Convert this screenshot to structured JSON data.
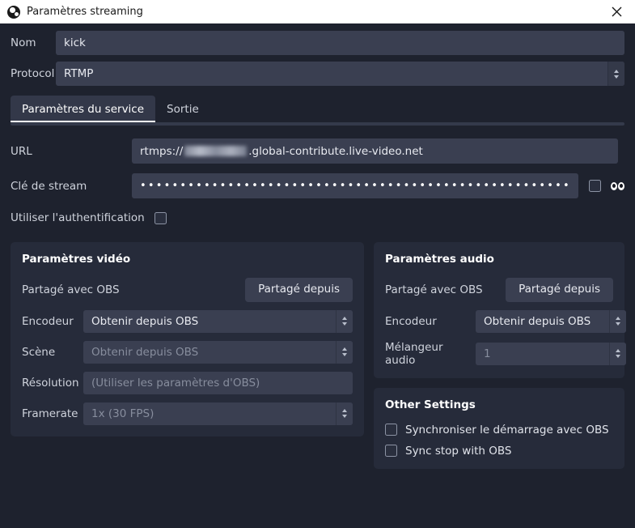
{
  "titlebar": {
    "title": "Paramètres streaming",
    "app_icon": "obs-logo-icon",
    "close_icon": "close-icon"
  },
  "colors": {
    "window_bg": "#1e222e",
    "field_bg": "#3a3f51",
    "group_bg": "#262b3a",
    "titlebar_bg": "#ffffff",
    "text": "#e4e6eb",
    "disabled_text": "#878d9d",
    "active_tab_underline": "#ffffff"
  },
  "top": {
    "name_label": "Nom",
    "name_value": "kick",
    "protocol_label": "Protocol",
    "protocol_value": "RTMP"
  },
  "tabs": [
    {
      "label": "Paramètres du service",
      "active": true
    },
    {
      "label": "Sortie",
      "active": false
    }
  ],
  "service": {
    "url_label": "URL",
    "url_prefix": "rtmps://",
    "url_redacted": "",
    "url_suffix": ".global-contribute.live-video.net",
    "stream_key_label": "Clé de stream",
    "stream_key_value": "••••••••••••••••••••••••••••••••••••••••••••••••••••••",
    "show_key_checkbox": "",
    "reveal_icon": "eyes-icon",
    "auth_label": "Utiliser l'authentification",
    "auth_checked": false
  },
  "video": {
    "title": "Paramètres vidéo",
    "shared_label": "Partagé avec OBS",
    "shared_button": "Partagé depuis",
    "encoder_label": "Encodeur",
    "encoder_value": "Obtenir depuis OBS",
    "scene_label": "Scène",
    "scene_value": "Obtenir depuis OBS",
    "resolution_label": "Résolution",
    "resolution_placeholder": "(Utiliser les paramètres d'OBS)",
    "framerate_label": "Framerate",
    "framerate_value": "1x (30 FPS)"
  },
  "audio": {
    "title": "Paramètres audio",
    "shared_label": "Partagé avec OBS",
    "shared_button": "Partagé depuis",
    "encoder_label": "Encodeur",
    "encoder_value": "Obtenir depuis OBS",
    "mixer_label": "Mélangeur audio",
    "mixer_value": "1"
  },
  "other": {
    "title": "Other Settings",
    "sync_start_label": "Synchroniser le démarrage avec OBS",
    "sync_start_checked": false,
    "sync_stop_label": "Sync stop with OBS",
    "sync_stop_checked": false
  }
}
